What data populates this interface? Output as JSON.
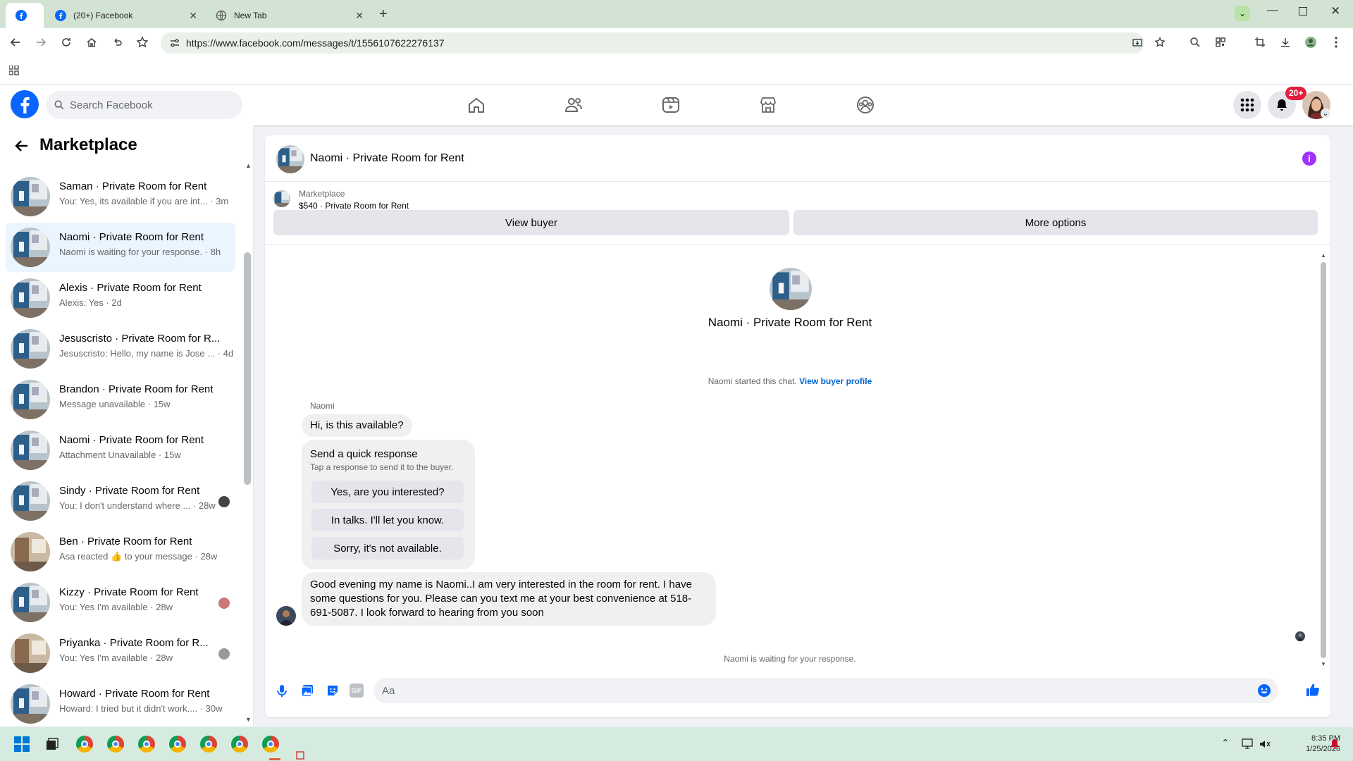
{
  "browser": {
    "tabs": [
      {
        "title": "",
        "active": true
      },
      {
        "title": "(20+) Facebook"
      },
      {
        "title": "New Tab"
      }
    ],
    "url": "https://www.facebook.com/messages/t/1556107622276137"
  },
  "header": {
    "search_placeholder": "Search Facebook",
    "notification_badge": "20+"
  },
  "sidebar": {
    "title": "Marketplace",
    "conversations": [
      {
        "name": "Saman · Private Room for Rent",
        "preview": "You: Yes, its available if you are int... · 3m",
        "selected": false
      },
      {
        "name": "Naomi · Private Room for Rent",
        "preview": "Naomi is waiting for your response. · 8h",
        "selected": true
      },
      {
        "name": "Alexis · Private Room for Rent",
        "preview": "Alexis: Yes · 2d",
        "selected": false
      },
      {
        "name": "Jesuscristo · Private Room for R...",
        "preview": "Jesuscristo: Hello, my name is Jose ... · 4d",
        "selected": false
      },
      {
        "name": "Brandon · Private Room for Rent",
        "preview": "Message unavailable · 15w",
        "selected": false
      },
      {
        "name": "Naomi · Private Room for Rent",
        "preview": "Attachment Unavailable · 15w",
        "selected": false
      },
      {
        "name": "Sindy · Private Room for Rent",
        "preview": "You: I don't understand where ... · 28w",
        "selected": false
      },
      {
        "name": "Ben · Private Room for Rent",
        "preview": "Asa reacted 👍 to your message · 28w",
        "selected": false
      },
      {
        "name": "Kizzy · Private Room for Rent",
        "preview": "You: Yes I'm available · 28w",
        "selected": false
      },
      {
        "name": "Priyanka · Private Room for R...",
        "preview": "You: Yes I'm available · 28w",
        "selected": false
      },
      {
        "name": "Howard · Private Room for Rent",
        "preview": "Howard: I tried but it didn't work.... · 30w",
        "selected": false
      }
    ]
  },
  "chat": {
    "title": "Naomi · Private Room for Rent",
    "marketplace_label": "Marketplace",
    "listing": "$540 · Private Room for Rent",
    "view_buyer": "View buyer",
    "more_options": "More options",
    "intro_title": "Naomi · Private Room for Rent",
    "started_text": "Naomi started this chat.",
    "view_buyer_profile": "View buyer profile",
    "sender_name": "Naomi",
    "first_message": "Hi, is this available?",
    "quick_response_title": "Send a quick response",
    "quick_response_sub": "Tap a response to send it to the buyer.",
    "quick_responses": [
      "Yes, are you interested?",
      "In talks. I'll let you know.",
      "Sorry, it's not available."
    ],
    "second_message": "Good evening my name is Naomi..I am very interested in the room for rent. I have some questions for you. Please can you text me at your best convenience at 518-691-5087. I look forward to hearing from you soon",
    "waiting_text": "Naomi is waiting for your response.",
    "composer_placeholder": "Aa"
  },
  "taskbar": {
    "time": "8:35 PM",
    "date": "1/25/2026"
  },
  "colors": {
    "fb_blue": "#0866ff",
    "info_purple": "#a033ff",
    "notif_red": "#e41e3f"
  }
}
